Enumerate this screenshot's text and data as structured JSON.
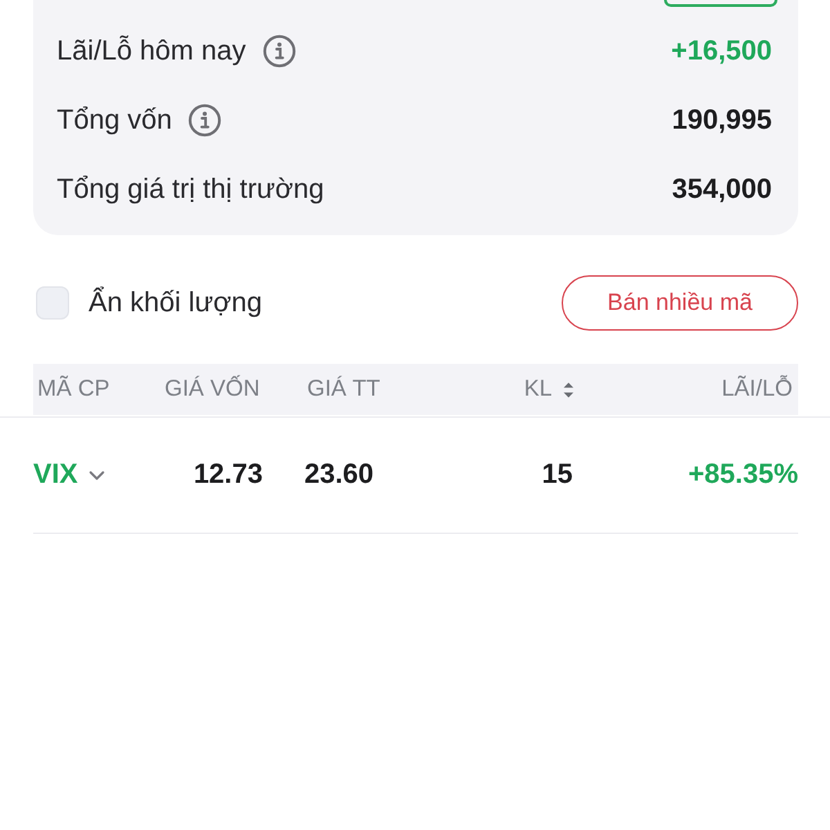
{
  "summary": [
    {
      "label": "Lãi/Lỗ hôm nay",
      "has_info": true,
      "value": "+16,500",
      "positive": true
    },
    {
      "label": "Tổng vốn",
      "has_info": true,
      "value": "190,995",
      "positive": false
    },
    {
      "label": "Tổng giá trị thị trường",
      "has_info": false,
      "value": "354,000",
      "positive": false
    }
  ],
  "hide_volume": {
    "label": "Ẩn khối lượng",
    "checked": false
  },
  "sell_button": {
    "label": "Bán nhiều mã"
  },
  "table": {
    "columns": [
      {
        "label": "MÃ CP",
        "sortable": false
      },
      {
        "label": "GIÁ VỐN",
        "sortable": false
      },
      {
        "label": "GIÁ TT",
        "sortable": false
      },
      {
        "label": "KL",
        "sortable": true
      },
      {
        "label": "LÃI/LỖ",
        "sortable": false
      }
    ],
    "rows": [
      {
        "symbol": "VIX",
        "expanded": false,
        "cost_price": "12.73",
        "market_price": "23.60",
        "volume": "15",
        "profit": "+85.35%",
        "positive": true
      }
    ]
  }
}
